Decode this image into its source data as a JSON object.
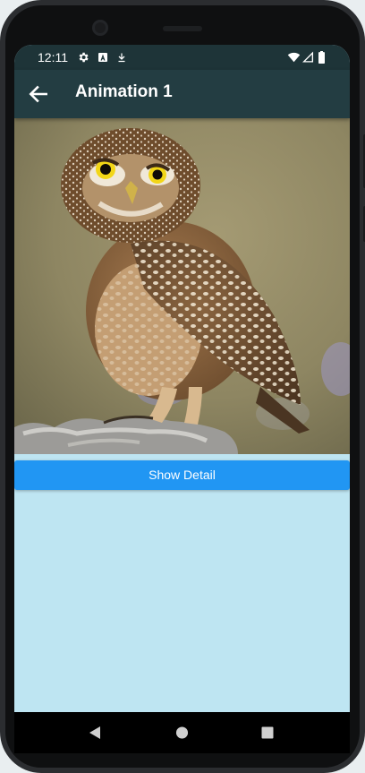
{
  "status_bar": {
    "time": "12:11",
    "icons": [
      "gear-icon",
      "a-badge-icon",
      "download-icon",
      "wifi-icon",
      "cellular-icon",
      "battery-icon"
    ]
  },
  "app_bar": {
    "title": "Animation 1",
    "back_icon": "arrow-back-icon"
  },
  "content": {
    "image_subject": "owl-photo",
    "button_label": "Show Detail"
  },
  "nav_bar": {
    "icons": [
      "back-triangle-icon",
      "home-circle-icon",
      "recents-square-icon"
    ]
  },
  "colors": {
    "status_bar": "#1e3438",
    "app_bar": "#233d42",
    "button": "#2196f3",
    "body_background": "#bee5f2"
  }
}
